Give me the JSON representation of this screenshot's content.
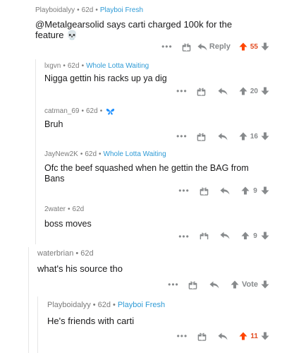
{
  "colors": {
    "upvote": "#ff4500",
    "icon_gray": "#878a8c",
    "flair": "#2f9bd6",
    "butterfly": "#1e90ff",
    "thread_line": "#e6e6e6"
  },
  "icons": {
    "more": "more-icon",
    "award": "award-icon",
    "reply": "reply-icon",
    "upvote": "upvote-icon",
    "downvote": "downvote-icon",
    "butterfly": "butterfly-icon",
    "skull": "skull-emoji"
  },
  "comments": [
    {
      "user": "Playboidalyy",
      "sep": "•",
      "time": "62d",
      "flair": "Playboi Fresh",
      "body": "@Metalgearsolid says carti charged 100k for the feature 💀",
      "more": "•••",
      "reply_label": "Reply",
      "score": "55",
      "upvoted": true
    },
    {
      "user": "lxgvn",
      "sep": "•",
      "time": "62d",
      "flair": "Whole Lotta Waiting",
      "body": "Nigga gettin his racks up ya dig",
      "more": "•••",
      "score": "20"
    },
    {
      "user": "catman_69",
      "sep": "•",
      "time": "62d",
      "flair": "",
      "body": "Bruh",
      "more": "•••",
      "score": "16"
    },
    {
      "user": "JayNew2K",
      "sep": "•",
      "time": "62d",
      "flair": "Whole Lotta Waiting",
      "body": "Ofc the beef squashed when he gettin the BAG from Bans",
      "more": "•••",
      "score": "9"
    },
    {
      "user": "2water",
      "sep": "•",
      "time": "62d",
      "flair": "",
      "body": "boss moves",
      "more": "•••",
      "score": "9"
    },
    {
      "user": "waterbrian",
      "sep": "•",
      "time": "62d",
      "flair": "",
      "body": "what's his source tho",
      "more": "•••",
      "score": "Vote"
    },
    {
      "user": "Playboidalyy",
      "sep": "•",
      "time": "62d",
      "flair": "Playboi Fresh",
      "body": "He's friends with carti",
      "more": "•••",
      "score": "11",
      "upvoted": true
    }
  ]
}
